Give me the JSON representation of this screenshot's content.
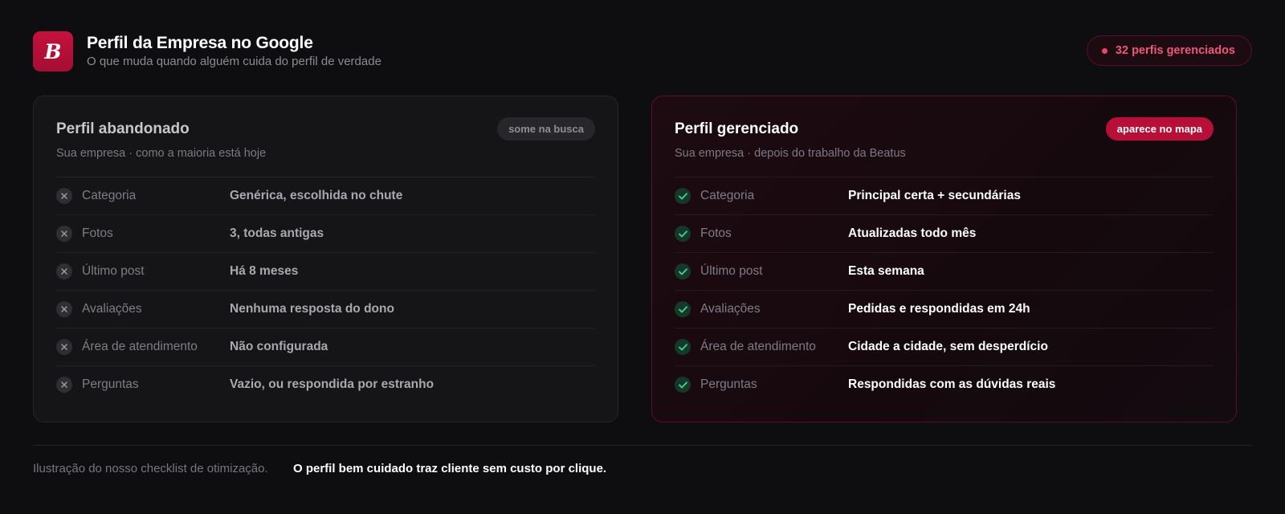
{
  "header": {
    "logo_letter": "B",
    "title": "Perfil da Empresa no Google",
    "subtitle": "O que muda quando alguém cuida do perfil de verdade",
    "managed_pill": {
      "label": "32 perfis gerenciados",
      "dot_color": "#f0436b"
    }
  },
  "left_card": {
    "title": "Perfil abandonado",
    "subtitle": "Sua empresa · como a maioria está hoje",
    "badge": "some na busca",
    "status_icon": "x-icon",
    "rows": [
      {
        "label": "Categoria",
        "value": "Genérica, escolhida no chute"
      },
      {
        "label": "Fotos",
        "value": "3, todas antigas"
      },
      {
        "label": "Último post",
        "value": "Há 8 meses"
      },
      {
        "label": "Avaliações",
        "value": "Nenhuma resposta do dono"
      },
      {
        "label": "Área de atendimento",
        "value": "Não configurada"
      },
      {
        "label": "Perguntas",
        "value": "Vazio, ou respondida por estranho"
      }
    ]
  },
  "right_card": {
    "title": "Perfil gerenciado",
    "subtitle": "Sua empresa · depois do trabalho da Beatus",
    "badge": "aparece no mapa",
    "status_icon": "check-icon",
    "rows": [
      {
        "label": "Categoria",
        "value": "Principal certa + secundárias"
      },
      {
        "label": "Fotos",
        "value": "Atualizadas todo mês"
      },
      {
        "label": "Último post",
        "value": "Esta semana"
      },
      {
        "label": "Avaliações",
        "value": "Pedidas e respondidas em 24h"
      },
      {
        "label": "Área de atendimento",
        "value": "Cidade a cidade, sem desperdício"
      },
      {
        "label": "Perguntas",
        "value": "Respondidas com as dúvidas reais"
      }
    ]
  },
  "footer": {
    "note": "Ilustração do nosso checklist de otimização.",
    "highlight": "O perfil bem cuidado traz cliente sem custo por clique."
  },
  "colors": {
    "brand": "#b80f38",
    "accent_pink": "#f0557a",
    "check_green": "#3fd68a",
    "background": "#0e0e10"
  }
}
